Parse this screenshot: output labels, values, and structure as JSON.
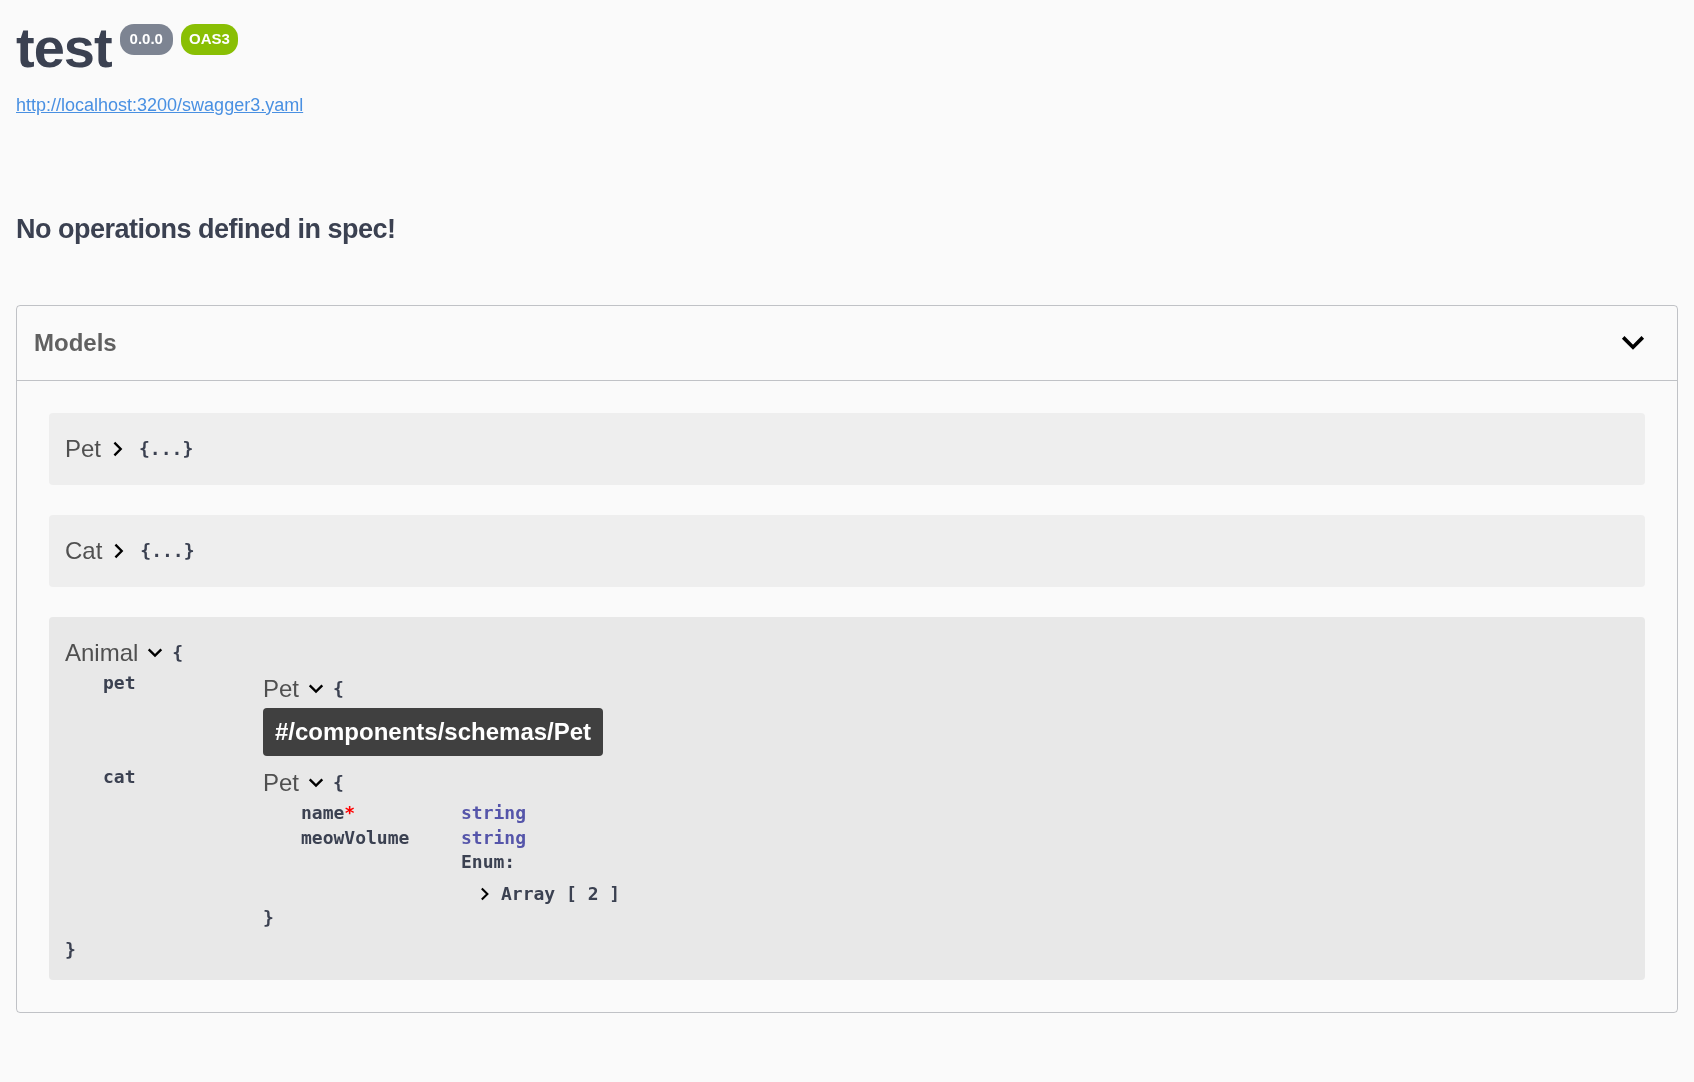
{
  "info": {
    "title": "test",
    "version": "0.0.0",
    "spec_badge": "OAS3",
    "url": "http://localhost:3200/swagger3.yaml"
  },
  "message": "No operations defined in spec!",
  "models": {
    "title": "Models",
    "expanded": true,
    "items": [
      {
        "name": "Pet",
        "expanded": false,
        "collapsed_text": "{...}"
      },
      {
        "name": "Cat",
        "expanded": false,
        "collapsed_text": "{...}"
      },
      {
        "name": "Animal",
        "expanded": true,
        "open_brace": "{",
        "close_brace": "}",
        "properties": [
          {
            "name": "pet",
            "model": {
              "name": "Pet",
              "expanded": true,
              "open_brace": "{"
            }
          },
          {
            "name": "cat",
            "model": {
              "name": "Pet",
              "expanded": true,
              "open_brace": "{",
              "close_brace": "}",
              "properties": [
                {
                  "name": "name",
                  "required_mark": "*",
                  "type": "string"
                },
                {
                  "name": "meowVolume",
                  "type": "string",
                  "enum_label": "Enum:",
                  "enum_value": {
                    "expanded": false,
                    "text": "Array [ 2 ]"
                  }
                }
              ]
            }
          }
        ]
      }
    ]
  },
  "tooltip": {
    "text": "#/components/schemas/Pet"
  }
}
